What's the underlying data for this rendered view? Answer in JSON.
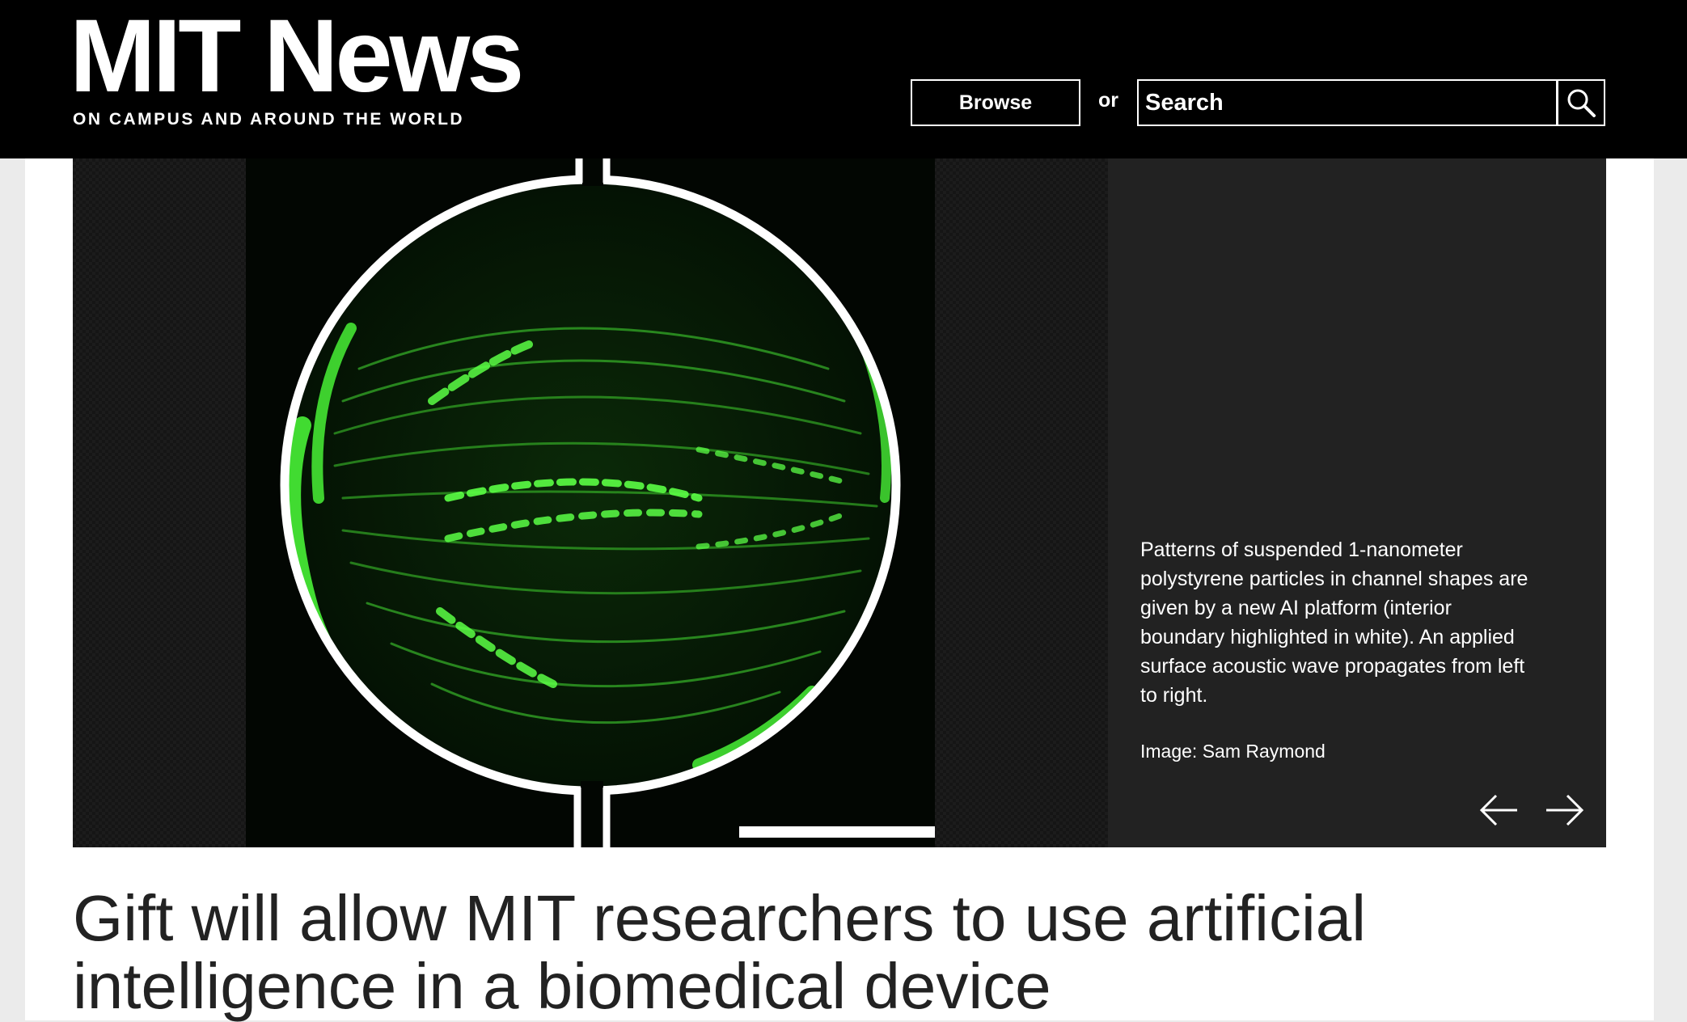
{
  "header": {
    "logo_title": "MIT News",
    "logo_tagline": "ON CAMPUS AND AROUND THE WORLD",
    "browse_label": "Browse",
    "or_text": "or",
    "search_placeholder": "Search",
    "search_icon": "magnifier-icon"
  },
  "hero": {
    "caption": "Patterns of suspended 1-nanometer polystyrene particles in channel shapes are given by a new AI platform (interior boundary highlighted in white). An applied surface acoustic wave propagates from left to right.",
    "credit": "Image: Sam Raymond",
    "prev_icon": "arrow-left-icon",
    "next_icon": "arrow-right-icon"
  },
  "article": {
    "headline": "Gift will allow MIT researchers to use artificial intelligence in a biomedical device"
  },
  "colors": {
    "header_bg": "#000000",
    "caption_bg": "#222222",
    "particle_green": "#4cff3a",
    "headline_text": "#222222"
  }
}
